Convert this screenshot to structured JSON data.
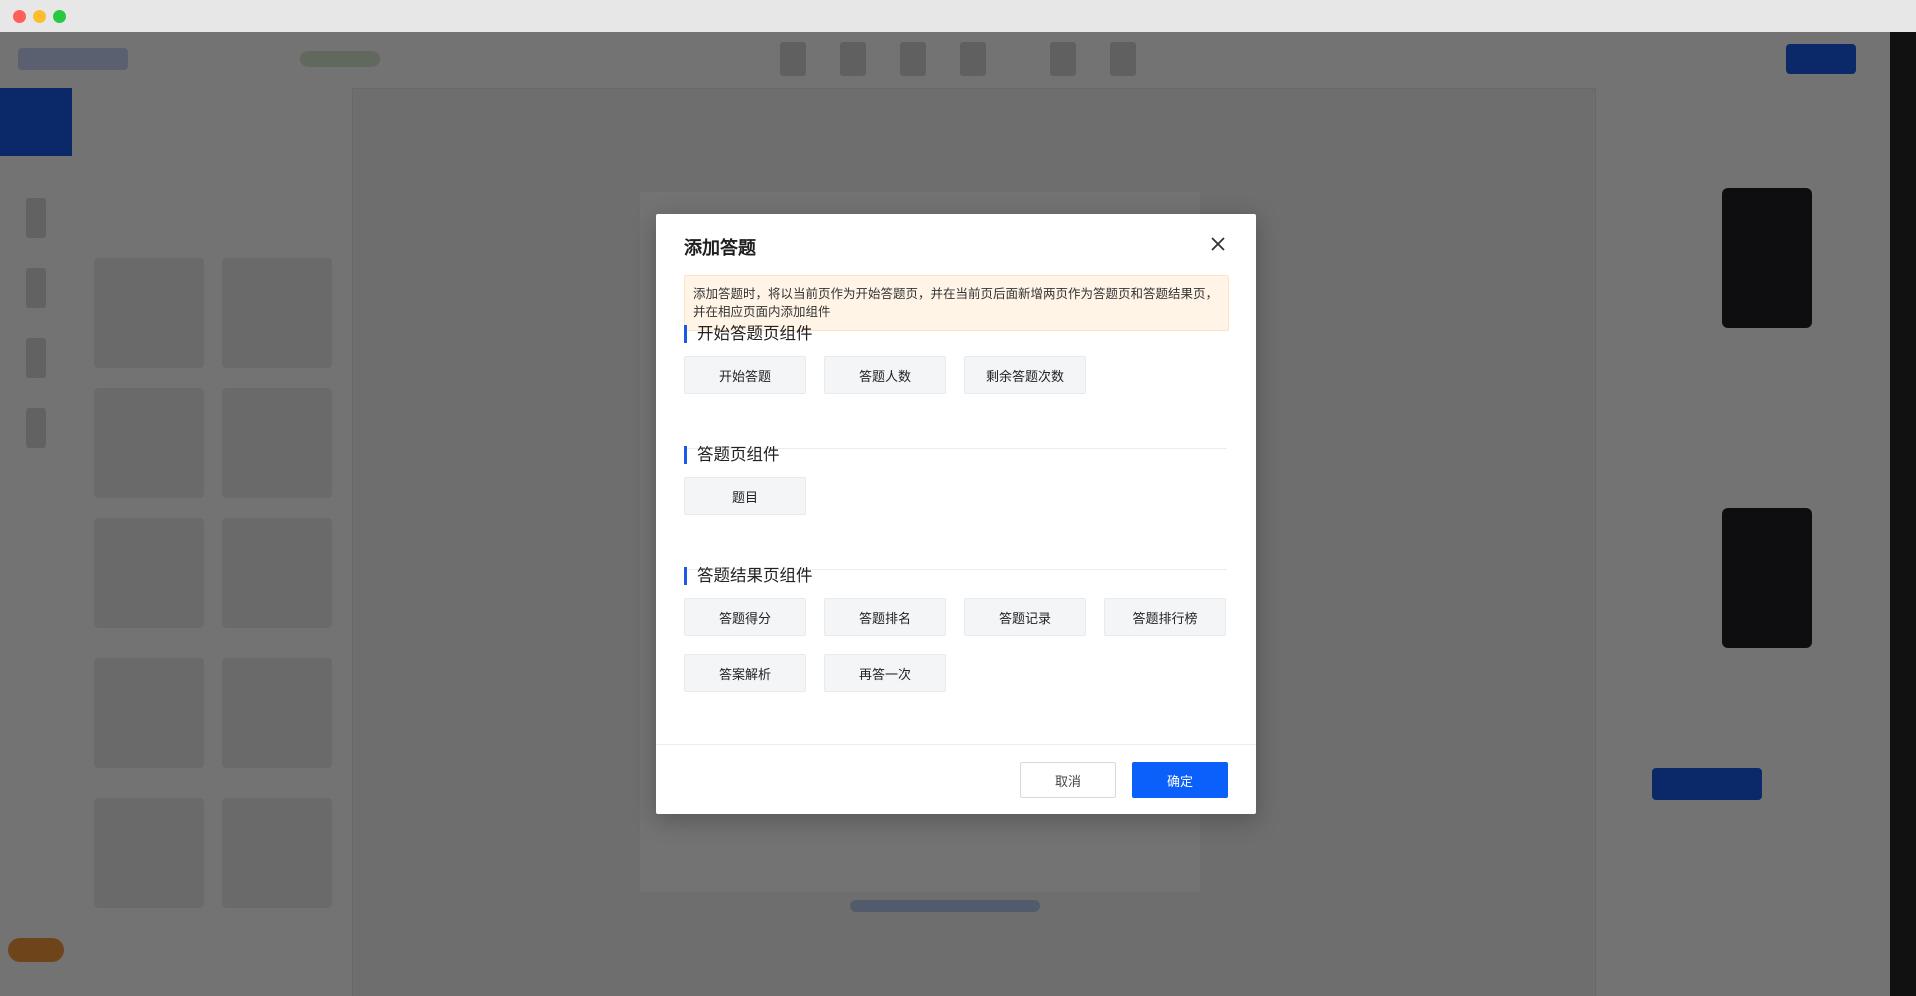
{
  "dialog": {
    "title": "添加答题",
    "notice": "添加答题时，将以当前页作为开始答题页，并在当前页后面新增两页作为答题页和答题结果页，并在相应页面内添加组件",
    "sections": [
      {
        "title": "开始答题页组件",
        "items": [
          "开始答题",
          "答题人数",
          "剩余答题次数"
        ]
      },
      {
        "title": "答题页组件",
        "items": [
          "题目"
        ]
      },
      {
        "title": "答题结果页组件",
        "items": [
          "答题得分",
          "答题排名",
          "答题记录",
          "答题排行榜",
          "答案解析",
          "再答一次"
        ]
      }
    ],
    "cancel_label": "取消",
    "confirm_label": "确定"
  },
  "colors": {
    "primary": "#0b5ffa",
    "notice_bg": "#fff4e6",
    "section_bar": "#1a5be6"
  },
  "icons": {
    "close": "close-icon"
  }
}
